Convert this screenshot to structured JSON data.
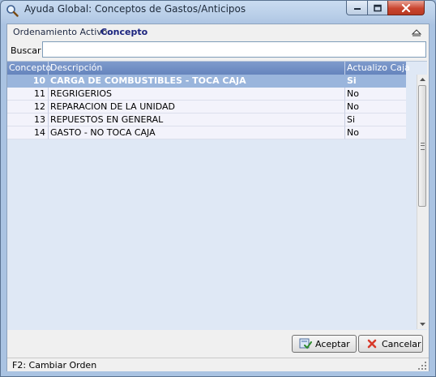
{
  "window": {
    "title": "Ayuda Global: Conceptos de Gastos/Anticipos"
  },
  "ordering": {
    "label": "Ordenamiento Activo:",
    "value": "Concepto"
  },
  "search": {
    "label": "Buscar",
    "value": ""
  },
  "table": {
    "columns": [
      "Concepto",
      "Descripción",
      "Actualizo Caja"
    ],
    "rows": [
      {
        "concepto": "10",
        "descripcion": "CARGA DE COMBUSTIBLES - TOCA CAJA",
        "actualizo": "Si",
        "selected": true
      },
      {
        "concepto": "11",
        "descripcion": "REGRIGERIOS",
        "actualizo": "No",
        "selected": false
      },
      {
        "concepto": "12",
        "descripcion": "REPARACION DE LA UNIDAD",
        "actualizo": "No",
        "selected": false
      },
      {
        "concepto": "13",
        "descripcion": "REPUESTOS EN GENERAL",
        "actualizo": "Si",
        "selected": false
      },
      {
        "concepto": "14",
        "descripcion": "GASTO - NO TOCA CAJA",
        "actualizo": "No",
        "selected": false
      }
    ]
  },
  "buttons": {
    "accept_label": "Aceptar",
    "accept_icon": "accept-icon",
    "cancel_label": "Cancelar",
    "cancel_icon": "cancel-x-icon"
  },
  "status": {
    "text": "F2: Cambiar Orden"
  },
  "colors": {
    "selected_row": "#9ab5dc",
    "header": "#6f8ec5",
    "ordering_value": "#1a237e"
  }
}
